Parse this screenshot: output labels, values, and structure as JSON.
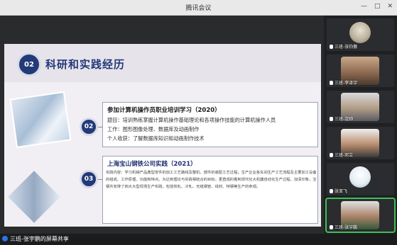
{
  "window": {
    "title": "腾讯会议"
  },
  "slide": {
    "section_number": "02",
    "section_title": "科研和实践经历",
    "card1": {
      "number": "02",
      "title": "参加计算机操作员职业培训学习（2020）",
      "line1": "题目：培训熟练掌握计算机操作基础理论和各项操作技能的计算机操作人员",
      "line2": "工作：图形图像处理、数据库及动画制作",
      "line3": "个人收获：了解数据库知识和动画制作技术"
    },
    "card2": {
      "number": "03",
      "title": "上海宝山钢铁公司实践（2021）",
      "para": "实践内容：学习机械产品典型零件的加工工艺路线及整机、部件的装配工艺过程；生产企业各车间生产工艺流程及主要加工设备的组成、工作原理、功能和特点。为达到理论与实践相结合的目标，更直观的看到现代化大机器自动化生产过程，加深印象，宝钢共安排了四大大型现场生产实践，包括热轧、冷轧、无缝钢管、线材、特钢等生产的参观。"
    }
  },
  "participants": [
    {
      "name": "三班-张钧傲"
    },
    {
      "name": "三班-李泽宇"
    },
    {
      "name": "三班-沈帅"
    },
    {
      "name": "三班-邓立"
    },
    {
      "name": "张亚飞"
    },
    {
      "name": "三班-张宇鹏"
    }
  ],
  "status": {
    "share_text": "三班-张宇鹏的屏幕共享"
  }
}
